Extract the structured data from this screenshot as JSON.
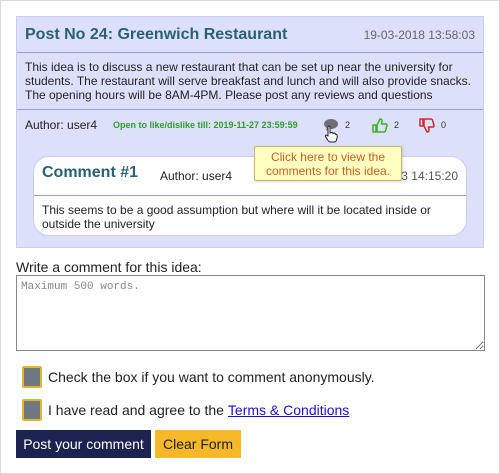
{
  "post": {
    "title": "Post No 24: Greenwich Restaurant",
    "date": "19-03-2018 13:58:03",
    "body": "This idea is to discuss a new restaurant that can be set up near the university for students. The restaurant will serve breakfast and lunch and will also provide snacks. The opening hours will be 8AM-4PM. Please post any reviews and questions",
    "author": "Author: user4",
    "open_till": "Open to like/dislike till: 2019-11-27 23:59:59",
    "comments_count": "2",
    "likes_count": "2",
    "dislikes_count": "0",
    "icons": {
      "comments": "speech-bubble-icon",
      "like": "thumbs-up-icon",
      "dislike": "thumbs-down-icon"
    }
  },
  "comment": {
    "title": "Comment #1",
    "author": "Author: user4",
    "date": "3 14:15:20",
    "body": "This seems to be a good assumption but where will it be located inside or outside the university"
  },
  "tooltip": {
    "text": "Click here to view the comments for this idea."
  },
  "form": {
    "label": "Write a comment for this idea:",
    "placeholder": "Maximum 500 words.",
    "value": "",
    "anonymous_label": "Check the box if you want to comment anonymously.",
    "terms_prefix": "I have read and agree to the",
    "terms_link": "Terms & Conditions",
    "post_button": "Post your comment",
    "clear_button": "Clear Form"
  },
  "colors": {
    "post_bg": "#dde0fb",
    "heading": "#2a6172",
    "open_till": "#2f9b2f",
    "like": "#3fae2a",
    "dislike": "#d4262b",
    "tooltip_bg": "#ffffc2",
    "tooltip_text": "#c25f1f",
    "primary_button": "#1d2350",
    "secondary_button": "#f4b829",
    "checkbox_border": "#e7b52b",
    "link": "#1a0dd6"
  }
}
